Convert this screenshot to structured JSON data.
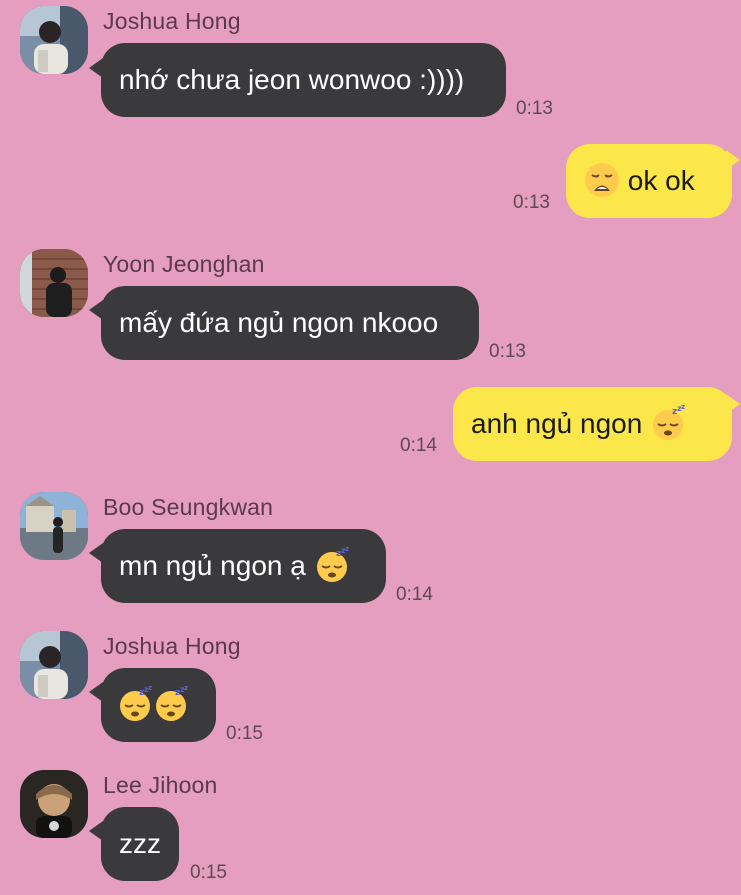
{
  "messages": [
    {
      "sender": "Joshua Hong",
      "text": "nhớ chưa jeon wonwoo :))))",
      "time": "0:13",
      "direction": "in"
    },
    {
      "sender": "",
      "text": "ok ok",
      "emoji_before": "weary-face",
      "time": "0:13",
      "direction": "out"
    },
    {
      "sender": "Yoon Jeonghan",
      "text": "mấy đứa ngủ ngon nkooo",
      "time": "0:13",
      "direction": "in"
    },
    {
      "sender": "",
      "text": "anh ngủ ngon",
      "emoji_after": "sleeping-face",
      "time": "0:14",
      "direction": "out"
    },
    {
      "sender": "Boo Seungkwan",
      "text": "mn ngủ ngon ạ",
      "emoji_after": "sleeping-face",
      "time": "0:14",
      "direction": "in"
    },
    {
      "sender": "Joshua Hong",
      "text": "",
      "emojis": [
        "sleeping-face",
        "sleeping-face"
      ],
      "time": "0:15",
      "direction": "in"
    },
    {
      "sender": "Lee Jihoon",
      "text": "zzz",
      "time": "0:15",
      "direction": "in"
    }
  ],
  "colors": {
    "background": "#e59ec0",
    "incoming_bubble": "#3a3a3c",
    "outgoing_bubble": "#fbe74a"
  }
}
